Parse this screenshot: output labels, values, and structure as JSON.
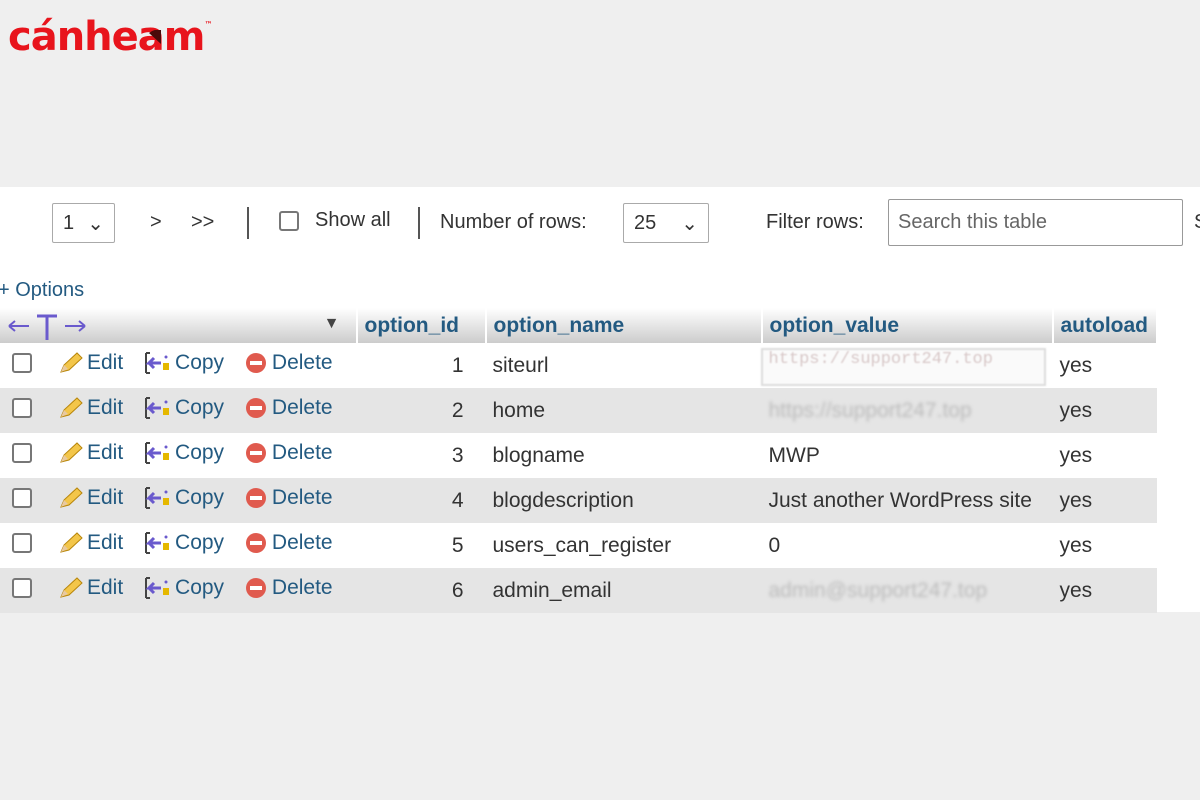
{
  "logo": {
    "text": "cánheam",
    "tm": "™",
    "color": "#e8141c"
  },
  "toolbar": {
    "page_select": "1",
    "next": ">",
    "last": ">>",
    "show_all": "Show all",
    "rows_label": "Number of rows:",
    "rows_select": "25",
    "filter_label": "Filter rows:",
    "search_placeholder": "Search this table",
    "cut_label": "S"
  },
  "options_link": "+ Options",
  "table": {
    "columns": [
      "option_id",
      "option_name",
      "option_value",
      "autoload"
    ],
    "actions": {
      "edit": "Edit",
      "copy": "Copy",
      "delete": "Delete"
    },
    "rows": [
      {
        "option_id": "1",
        "option_name": "siteurl",
        "option_value": "https://support247.top",
        "autoload": "yes"
      },
      {
        "option_id": "2",
        "option_name": "home",
        "option_value": "https://support247.top",
        "autoload": "yes"
      },
      {
        "option_id": "3",
        "option_name": "blogname",
        "option_value": "MWP",
        "autoload": "yes"
      },
      {
        "option_id": "4",
        "option_name": "blogdescription",
        "option_value": "Just another WordPress site",
        "autoload": "yes"
      },
      {
        "option_id": "5",
        "option_name": "users_can_register",
        "option_value": "0",
        "autoload": "yes"
      },
      {
        "option_id": "6",
        "option_name": "admin_email",
        "option_value": "admin@support247.top",
        "autoload": "yes"
      }
    ]
  },
  "colors": {
    "link": "#235a81",
    "row_alt": "#e5e5e5"
  }
}
